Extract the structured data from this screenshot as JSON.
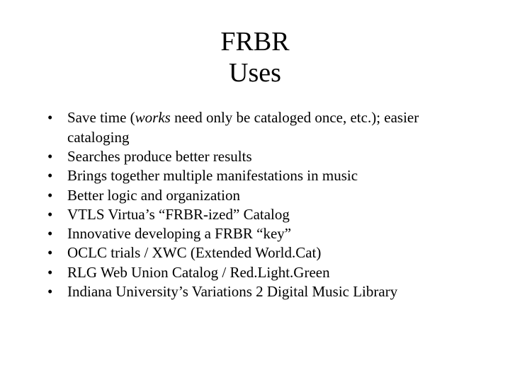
{
  "title": {
    "line1": "FRBR",
    "line2": "Uses"
  },
  "bullets": [
    {
      "pre": "Save time (",
      "italic": "works",
      "post": " need only be cataloged once, etc.); easier cataloging"
    },
    {
      "text": "Searches produce better results"
    },
    {
      "text": "Brings together multiple manifestations in music"
    },
    {
      "text": "Better logic and organization"
    },
    {
      "text": "VTLS Virtua’s “FRBR-ized” Catalog"
    },
    {
      "text": "Innovative developing a FRBR “key”"
    },
    {
      "text": "OCLC trials / XWC (Extended World.Cat)"
    },
    {
      "text": "RLG Web Union Catalog / Red.Light.Green"
    },
    {
      "text": "Indiana University’s Variations 2 Digital Music Library"
    }
  ]
}
